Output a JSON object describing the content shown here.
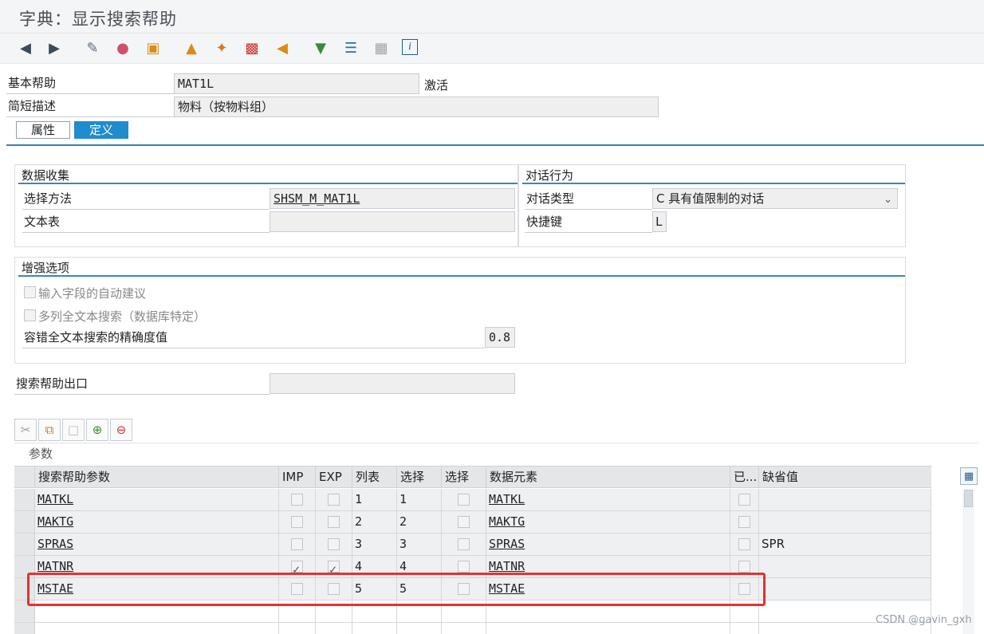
{
  "window": {
    "title": "字典：显示搜索帮助"
  },
  "toolbar": {
    "icons": [
      "back-icon",
      "forward-icon",
      "display-change-icon",
      "other-object-icon",
      "activate-icon",
      "where-used-icon",
      "magic-wand-icon",
      "test-icon",
      "object-list-icon",
      "hierarchy-icon",
      "align-icon",
      "table-icon",
      "info-icon"
    ]
  },
  "header": {
    "basic_help_label": "基本帮助",
    "basic_help_value": "MAT1L",
    "status": "激活",
    "short_desc_label": "简短描述",
    "short_desc_value": "物料（按物料组）"
  },
  "tabs": [
    {
      "label": "属性",
      "active": false
    },
    {
      "label": "定义",
      "active": true
    }
  ],
  "data_collection": {
    "title": "数据收集",
    "selection_method_label": "选择方法",
    "selection_method_value": "SHSM_M_MAT1L",
    "text_table_label": "文本表",
    "text_table_value": ""
  },
  "dialog_behavior": {
    "title": "对话行为",
    "dialog_type_label": "对话类型",
    "dialog_type_value": "C 具有值限制的对话",
    "hotkey_label": "快捷键",
    "hotkey_value": "L"
  },
  "enhanced_options": {
    "title": "增强选项",
    "auto_suggest_label": "输入字段的自动建议",
    "multi_column_label": "多列全文本搜索（数据库特定）",
    "fuzzy_label": "容错全文本搜索的精确度值",
    "fuzzy_value": "0.8"
  },
  "exit": {
    "label": "搜索帮助出口",
    "value": ""
  },
  "params_table": {
    "caption": "参数",
    "columns": [
      "搜索帮助参数",
      "IMP",
      "EXP",
      "列表",
      "选择",
      "选择",
      "数据元素",
      "已...",
      "缺省值"
    ],
    "rows": [
      {
        "param": "MATKL",
        "imp": false,
        "exp": false,
        "lpos": "1",
        "spos": "1",
        "sdis": false,
        "element": "MATKL",
        "modified": false,
        "default": ""
      },
      {
        "param": "MAKTG",
        "imp": false,
        "exp": false,
        "lpos": "2",
        "spos": "2",
        "sdis": false,
        "element": "MAKTG",
        "modified": false,
        "default": ""
      },
      {
        "param": "SPRAS",
        "imp": false,
        "exp": false,
        "lpos": "3",
        "spos": "3",
        "sdis": false,
        "element": "SPRAS",
        "modified": false,
        "default": "SPR"
      },
      {
        "param": "MATNR",
        "imp": true,
        "exp": true,
        "lpos": "4",
        "spos": "4",
        "sdis": false,
        "element": "MATNR",
        "modified": false,
        "default": ""
      },
      {
        "param": "MSTAE",
        "imp": false,
        "exp": false,
        "lpos": "5",
        "spos": "5",
        "sdis": false,
        "element": "MSTAE",
        "modified": false,
        "default": ""
      }
    ]
  },
  "watermark": "CSDN @gavin_gxh",
  "colors": {
    "accent": "#1f8ccd",
    "highlight": "#e83030"
  }
}
